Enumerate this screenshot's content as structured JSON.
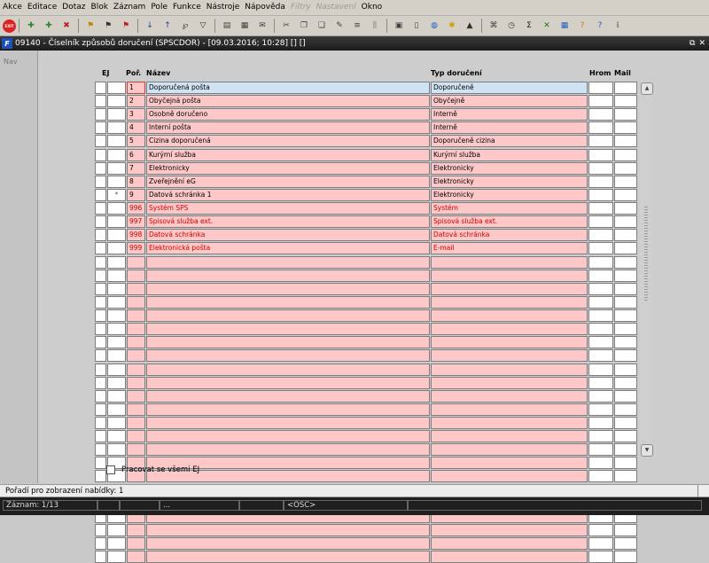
{
  "menubar": {
    "items": [
      {
        "label": "Akce",
        "disabled": false
      },
      {
        "label": "Editace",
        "disabled": false
      },
      {
        "label": "Dotaz",
        "disabled": false
      },
      {
        "label": "Blok",
        "disabled": false
      },
      {
        "label": "Záznam",
        "disabled": false
      },
      {
        "label": "Pole",
        "disabled": false
      },
      {
        "label": "Funkce",
        "disabled": false
      },
      {
        "label": "Nástroje",
        "disabled": false
      },
      {
        "label": "Nápověda",
        "disabled": false
      },
      {
        "label": "Filtry",
        "disabled": true
      },
      {
        "label": "Nastavení",
        "disabled": true
      },
      {
        "label": "Okno",
        "disabled": false
      }
    ]
  },
  "toolbar": {
    "exit_label": "EXIT",
    "icons": [
      {
        "name": "save-icon",
        "glyph": "✚",
        "color": "#2a8a2a"
      },
      {
        "name": "insert-record-icon",
        "glyph": "✚",
        "color": "#2a8a2a"
      },
      {
        "name": "delete-record-icon",
        "glyph": "✖",
        "color": "#c02020"
      },
      {
        "name": "sep"
      },
      {
        "name": "enter-query-icon",
        "glyph": "⚑",
        "color": "#c08000"
      },
      {
        "name": "execute-query-icon",
        "glyph": "⚑",
        "color": "#303030"
      },
      {
        "name": "cancel-query-icon",
        "glyph": "⚑",
        "color": "#c02020"
      },
      {
        "name": "sep"
      },
      {
        "name": "sort-asc-icon",
        "glyph": "↓",
        "color": "#2040a0"
      },
      {
        "name": "sort-desc-icon",
        "glyph": "↑",
        "color": "#2040a0"
      },
      {
        "name": "query-where-icon",
        "glyph": "℘",
        "color": "#303030"
      },
      {
        "name": "filter-icon",
        "glyph": "▽",
        "color": "#303030"
      },
      {
        "name": "sep"
      },
      {
        "name": "print-icon",
        "glyph": "▤",
        "color": "#404040"
      },
      {
        "name": "print-preview-icon",
        "glyph": "▦",
        "color": "#404040"
      },
      {
        "name": "mail-icon",
        "glyph": "✉",
        "color": "#404040"
      },
      {
        "name": "sep"
      },
      {
        "name": "cut-icon",
        "glyph": "✂",
        "color": "#404040"
      },
      {
        "name": "copy-icon",
        "glyph": "❐",
        "color": "#404040"
      },
      {
        "name": "paste-icon",
        "glyph": "❏",
        "color": "#404040"
      },
      {
        "name": "edit-icon",
        "glyph": "✎",
        "color": "#404040"
      },
      {
        "name": "list-icon",
        "glyph": "≡",
        "color": "#404040"
      },
      {
        "name": "columns-icon",
        "glyph": "⫼",
        "color": "#808080"
      },
      {
        "name": "sep"
      },
      {
        "name": "form-icon",
        "glyph": "▣",
        "color": "#404040"
      },
      {
        "name": "document-icon",
        "glyph": "▯",
        "color": "#404040"
      },
      {
        "name": "globe-icon",
        "glyph": "◍",
        "color": "#2060c0"
      },
      {
        "name": "star-icon",
        "glyph": "✱",
        "color": "#d0a000"
      },
      {
        "name": "warning-icon",
        "glyph": "▲",
        "color": "#303030"
      },
      {
        "name": "sep"
      },
      {
        "name": "shortcuts-icon",
        "glyph": "⌘",
        "color": "#404040"
      },
      {
        "name": "clock-icon",
        "glyph": "◷",
        "color": "#404040"
      },
      {
        "name": "sum-icon",
        "glyph": "Σ",
        "color": "#202020"
      },
      {
        "name": "excel-icon",
        "glyph": "✕",
        "color": "#1a7a1a"
      },
      {
        "name": "calendar-icon",
        "glyph": "▦",
        "color": "#2060c0"
      },
      {
        "name": "help-icon",
        "glyph": "?",
        "color": "#c08000"
      },
      {
        "name": "context-help-icon",
        "glyph": "?",
        "color": "#2060c0"
      },
      {
        "name": "info-icon",
        "glyph": "ℹ",
        "color": "#808080"
      }
    ]
  },
  "window": {
    "title": "09140 - Číselník způsobů doručení (SPSCDOR) - [09.03.2016; 10:28]  [] []",
    "restore_glyph": "⧉",
    "close_glyph": "✕"
  },
  "nav": {
    "label": "Nav"
  },
  "table": {
    "headers": {
      "ej": "EJ",
      "num": "Poř.",
      "name": "Název",
      "typ": "Typ doručení",
      "hrom": "Hrom",
      "mail": "Mail"
    },
    "rows": [
      {
        "ej": "",
        "num": "1",
        "name": "Doporučená pošta",
        "typ": "Doporučeně",
        "style": "current"
      },
      {
        "ej": "",
        "num": "2",
        "name": "Obyčejná pošta",
        "typ": "Obyčejně",
        "style": "normal"
      },
      {
        "ej": "",
        "num": "3",
        "name": "Osobně doručeno",
        "typ": "Interně",
        "style": "normal"
      },
      {
        "ej": "",
        "num": "4",
        "name": "Interní pošta",
        "typ": "Interně",
        "style": "normal"
      },
      {
        "ej": "",
        "num": "5",
        "name": "Cizina doporučená",
        "typ": "Doporučeně cizina",
        "style": "normal"
      },
      {
        "ej": "",
        "num": "6",
        "name": "Kurýrní služba",
        "typ": "Kurýrní služba",
        "style": "normal"
      },
      {
        "ej": "",
        "num": "7",
        "name": "Elektronicky",
        "typ": "Elektronicky",
        "style": "normal"
      },
      {
        "ej": "",
        "num": "8",
        "name": "Zveřejnění eG",
        "typ": "Elektronicky",
        "style": "normal"
      },
      {
        "ej": "*",
        "num": "9",
        "name": "Datová schránka 1",
        "typ": "Elektronicky",
        "style": "normal"
      },
      {
        "ej": "",
        "num": "996",
        "name": "Systém SPS",
        "typ": "Systém",
        "style": "red"
      },
      {
        "ej": "",
        "num": "997",
        "name": "Spisová služba ext.",
        "typ": "Spisová služba ext.",
        "style": "red"
      },
      {
        "ej": "",
        "num": "998",
        "name": "Datová schránka",
        "typ": "Datová schránka",
        "style": "red"
      },
      {
        "ej": "",
        "num": "999",
        "name": "Elektronická pošta",
        "typ": "E-mail",
        "style": "red"
      },
      {
        "ej": "",
        "num": "",
        "name": "",
        "typ": "",
        "style": "empty"
      },
      {
        "ej": "",
        "num": "",
        "name": "",
        "typ": "",
        "style": "empty"
      },
      {
        "ej": "",
        "num": "",
        "name": "",
        "typ": "",
        "style": "empty"
      },
      {
        "ej": "",
        "num": "",
        "name": "",
        "typ": "",
        "style": "empty"
      },
      {
        "ej": "",
        "num": "",
        "name": "",
        "typ": "",
        "style": "empty"
      },
      {
        "ej": "",
        "num": "",
        "name": "",
        "typ": "",
        "style": "empty"
      },
      {
        "ej": "",
        "num": "",
        "name": "",
        "typ": "",
        "style": "empty"
      },
      {
        "ej": "",
        "num": "",
        "name": "",
        "typ": "",
        "style": "empty"
      },
      {
        "ej": "",
        "num": "",
        "name": "",
        "typ": "",
        "style": "empty"
      },
      {
        "ej": "",
        "num": "",
        "name": "",
        "typ": "",
        "style": "empty"
      },
      {
        "ej": "",
        "num": "",
        "name": "",
        "typ": "",
        "style": "empty"
      },
      {
        "ej": "",
        "num": "",
        "name": "",
        "typ": "",
        "style": "empty"
      },
      {
        "ej": "",
        "num": "",
        "name": "",
        "typ": "",
        "style": "empty"
      },
      {
        "ej": "",
        "num": "",
        "name": "",
        "typ": "",
        "style": "empty"
      },
      {
        "ej": "",
        "num": "",
        "name": "",
        "typ": "",
        "style": "empty"
      },
      {
        "ej": "",
        "num": "",
        "name": "",
        "typ": "",
        "style": "empty"
      },
      {
        "ej": "",
        "num": "",
        "name": "",
        "typ": "",
        "style": "empty"
      },
      {
        "ej": "",
        "num": "",
        "name": "",
        "typ": "",
        "style": "empty"
      },
      {
        "ej": "",
        "num": "",
        "name": "",
        "typ": "",
        "style": "empty"
      },
      {
        "ej": "",
        "num": "",
        "name": "",
        "typ": "",
        "style": "empty"
      },
      {
        "ej": "",
        "num": "",
        "name": "",
        "typ": "",
        "style": "empty"
      },
      {
        "ej": "",
        "num": "",
        "name": "",
        "typ": "",
        "style": "empty"
      },
      {
        "ej": "",
        "num": "",
        "name": "",
        "typ": "",
        "style": "empty"
      }
    ]
  },
  "scrollbar": {
    "up_glyph": "▲",
    "down_glyph": "▼"
  },
  "options": {
    "all_ej_label": "Pracovat se všemi EJ",
    "all_ej_checked": false
  },
  "status": {
    "hint": "Pořadí pro zobrazení nabídky: 1",
    "record": "Záznam: 1/13",
    "field2": "",
    "field3": "",
    "field4": "...",
    "field5": "",
    "mode": "<OSC>",
    "field7": ""
  },
  "colors": {
    "row_fill": "#ffc8c8",
    "current_row": "#cfe3f4",
    "red_text": "#d40000"
  }
}
